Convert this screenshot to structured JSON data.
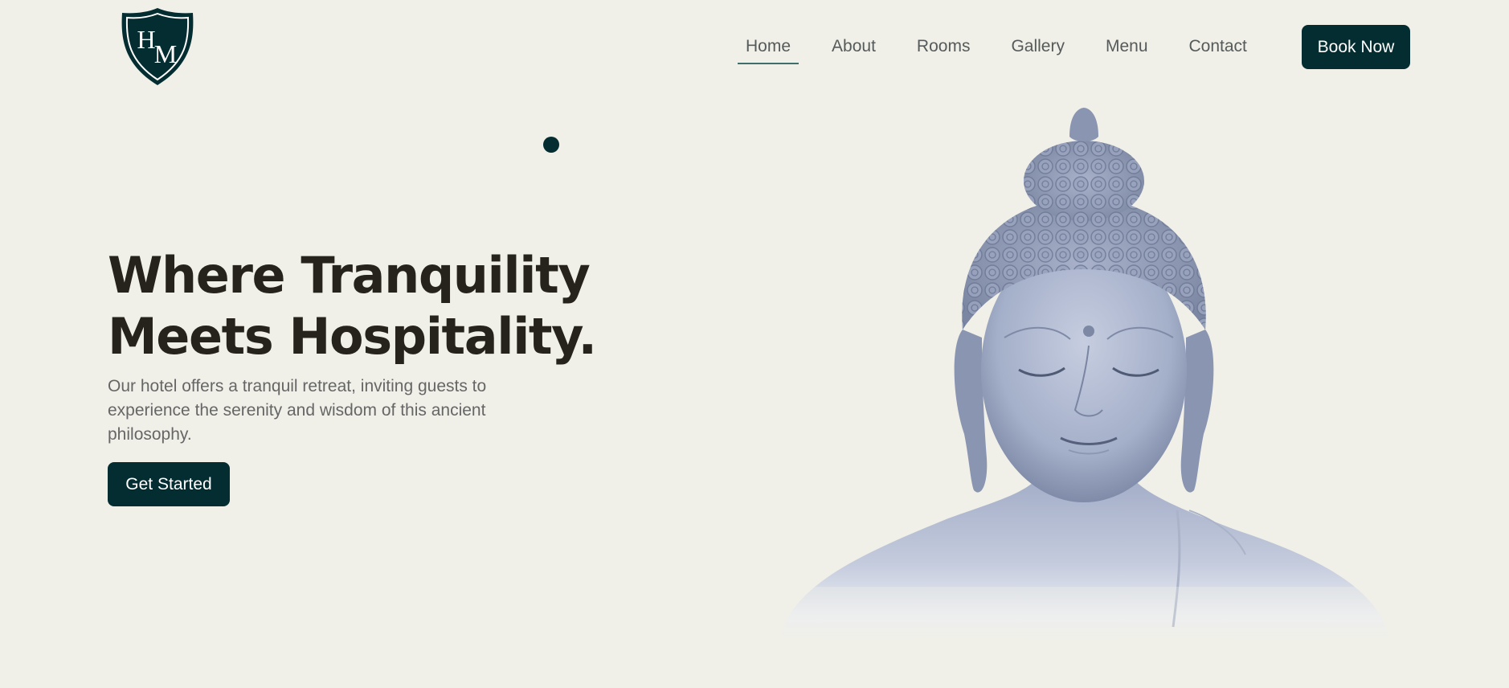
{
  "logo": {
    "letters": "HM",
    "letter_top": "H",
    "letter_bottom": "M",
    "color": "#042d31"
  },
  "nav": {
    "items": [
      {
        "label": "Home",
        "active": true
      },
      {
        "label": "About",
        "active": false
      },
      {
        "label": "Rooms",
        "active": false
      },
      {
        "label": "Gallery",
        "active": false
      },
      {
        "label": "Menu",
        "active": false
      },
      {
        "label": "Contact",
        "active": false
      }
    ],
    "book_label": "Book Now"
  },
  "hero": {
    "title_line1": "Where Tranquility",
    "title_line2": "Meets Hospitality.",
    "description": "Our hotel offers a tranquil retreat, inviting guests to experience the serenity and wisdom of this ancient philosophy.",
    "cta_label": "Get Started"
  },
  "colors": {
    "background": "#f0f0e8",
    "accent": "#042d31",
    "heading": "#26231d",
    "body_text": "#666666",
    "statue": "#a9b3cc"
  },
  "icons": {
    "logo": "shield-crest-icon",
    "hero_image": "buddha-statue-image",
    "decor": "dot-decoration"
  }
}
